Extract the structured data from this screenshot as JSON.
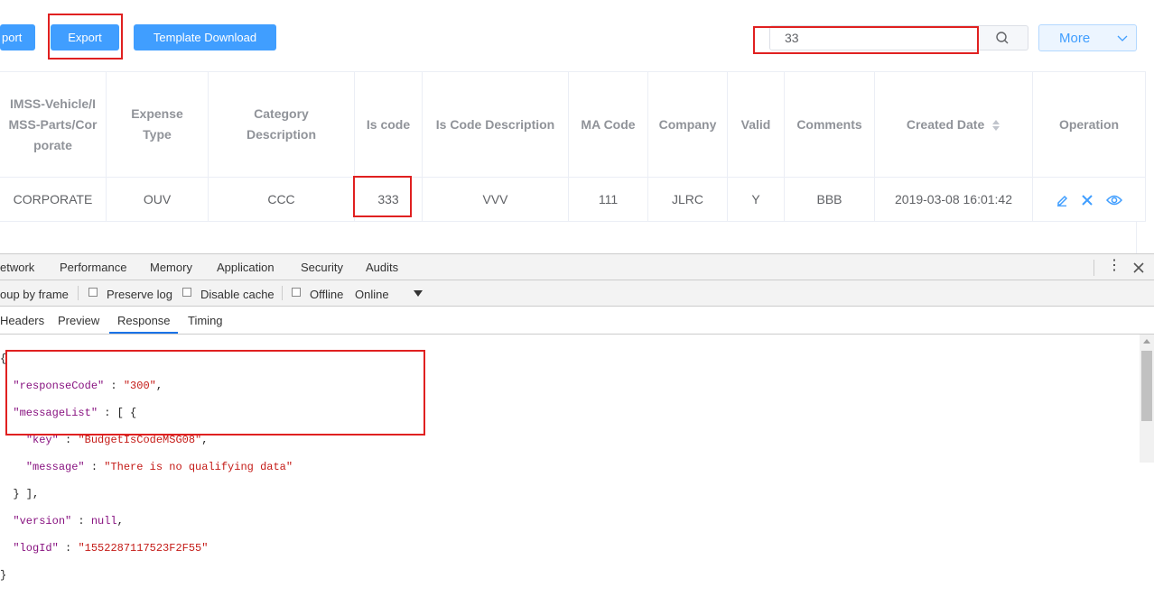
{
  "toolbar": {
    "import_label": "port",
    "export_label": "Export",
    "template_label": "Template Download",
    "search_value": "33",
    "more_label": "More"
  },
  "table": {
    "headers": {
      "col1": "IMSS-Vehicle/IMSS-Parts/Corporate",
      "col2": "Expense Type",
      "col3": "Category Description",
      "col4": "Is code",
      "col5": "Is Code Description",
      "col6": "MA Code",
      "col7": "Company",
      "col8": "Valid",
      "col9": "Comments",
      "col10": "Created Date",
      "col11": "Operation"
    },
    "row": {
      "c1": "CORPORATE",
      "c2": "OUV",
      "c3": "CCC",
      "c4": "333",
      "c5": "VVV",
      "c6": "111",
      "c7": "JLRC",
      "c8": "Y",
      "c9": "BBB",
      "c10": "2019-03-08 16:01:42"
    }
  },
  "devtools": {
    "tabs": [
      "etwork",
      "Performance",
      "Memory",
      "Application",
      "Security",
      "Audits"
    ],
    "options": {
      "group": "oup by frame",
      "preserve": "Preserve log",
      "disable": "Disable cache",
      "offline": "Offline",
      "throttle": "Online"
    },
    "subtabs": [
      "Headers",
      "Preview",
      "Response",
      "Timing"
    ],
    "response": {
      "open": "{",
      "k1": "\"responseCode\"",
      "v1": "\"300\"",
      "k2": "\"messageList\"",
      "k3": "\"key\"",
      "v3": "\"BudgetIsCodeMSG08\"",
      "k4": "\"message\"",
      "v4": "\"There is no qualifying data\"",
      "close_list": "} ],",
      "k5": "\"version\"",
      "v5": "null",
      "k6": "\"logId\"",
      "v6": "\"1552287117523F2F55\"",
      "close": "}"
    }
  },
  "colors": {
    "primary": "#409eff",
    "highlight": "#e02020"
  }
}
